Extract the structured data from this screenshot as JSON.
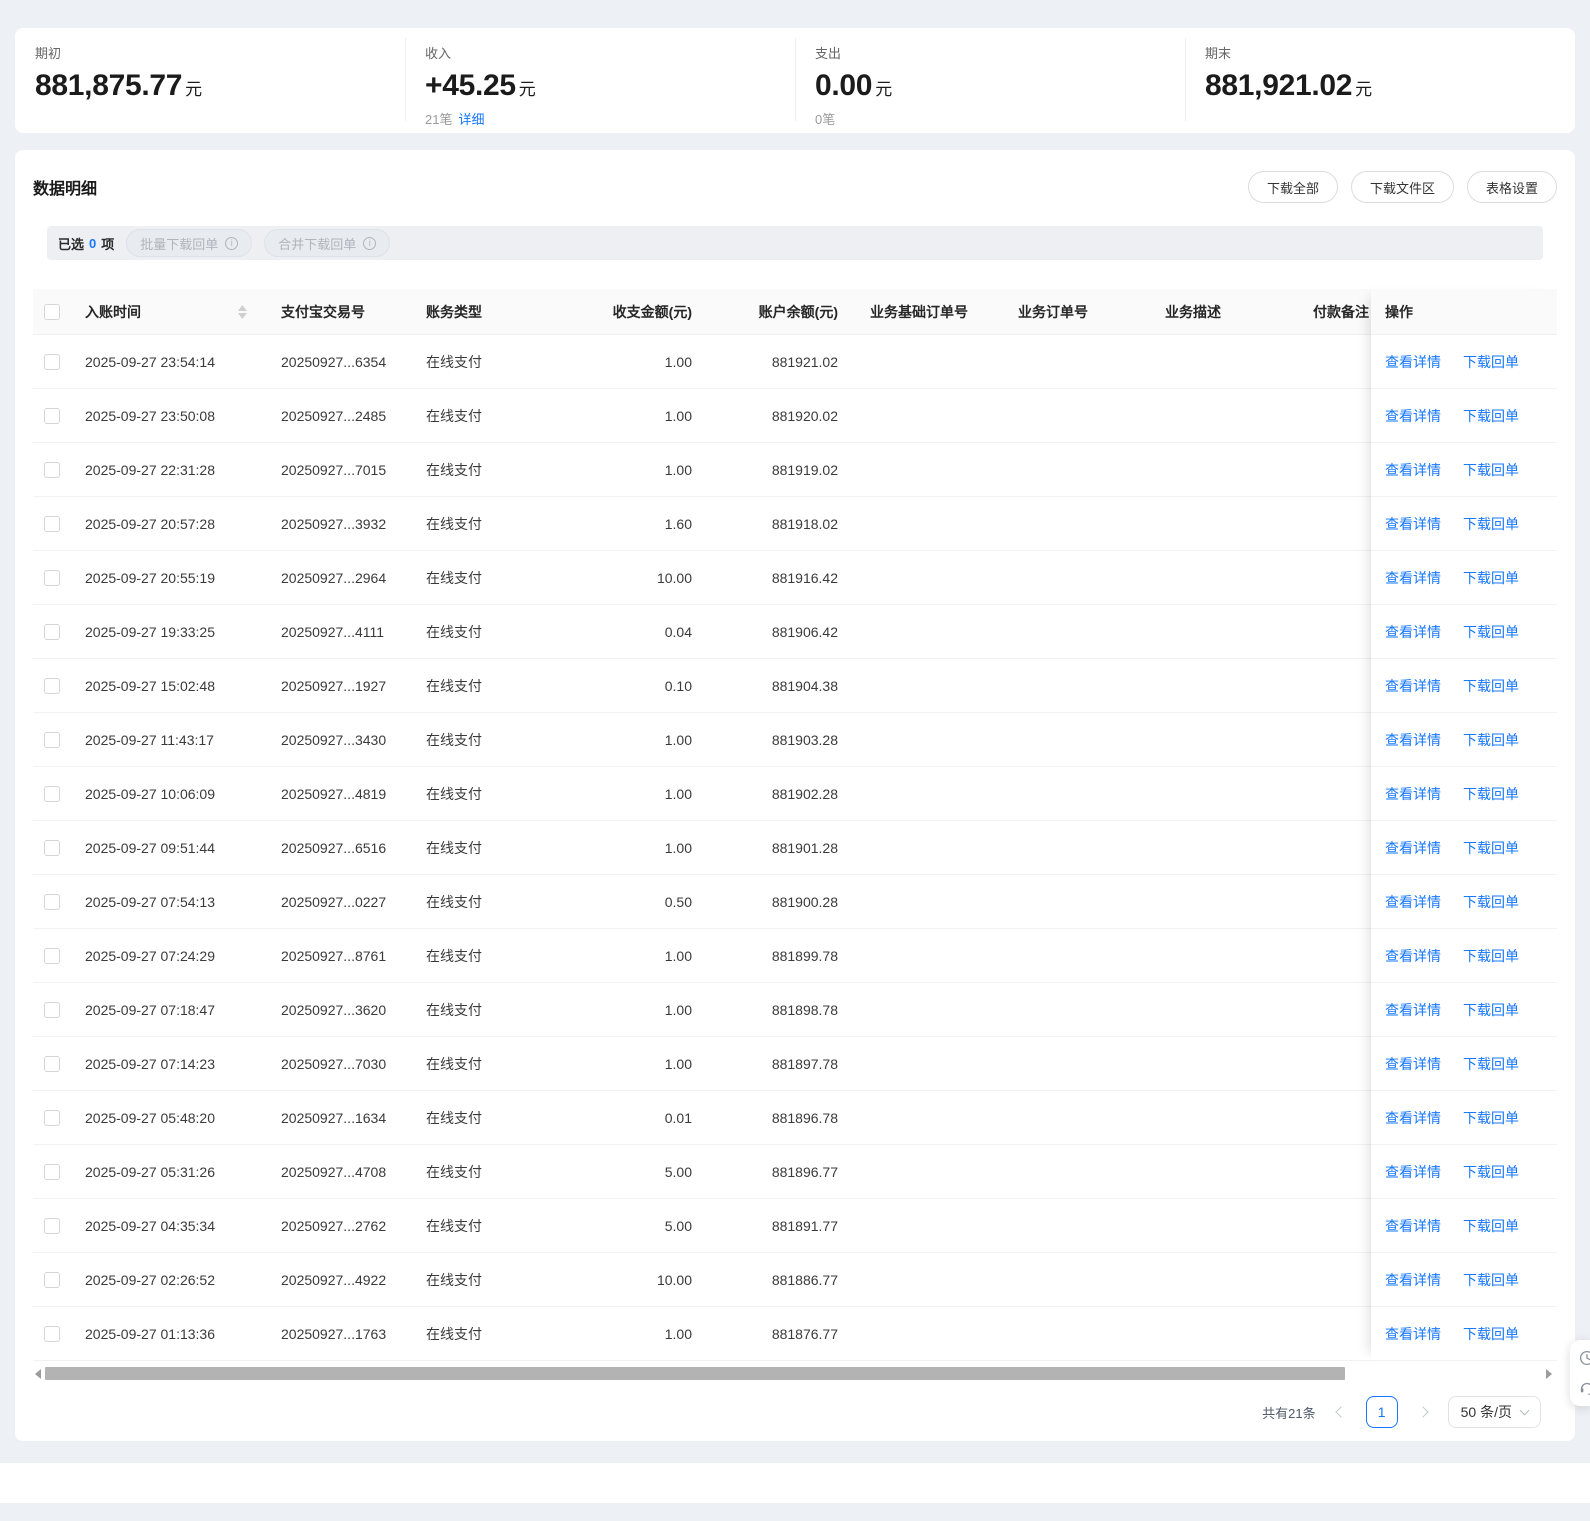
{
  "colors": {
    "accent": "#1677ff"
  },
  "summary_cards": [
    {
      "label": "期初",
      "value": "881,875.77",
      "unit": "元"
    },
    {
      "label": "收入",
      "value": "+45.25",
      "unit": "元",
      "count": "21笔",
      "link": "详细"
    },
    {
      "label": "支出",
      "value": "0.00",
      "unit": "元",
      "count": "0笔"
    },
    {
      "label": "期末",
      "value": "881,921.02",
      "unit": "元"
    }
  ],
  "panel": {
    "title": "数据明细",
    "buttons": {
      "download_all": "下载全部",
      "download_zone": "下载文件区",
      "table_settings": "表格设置"
    },
    "selection": {
      "prefix": "已选",
      "count": "0",
      "suffix": "项",
      "batch_download": "批量下载回单",
      "merge_download": "合并下载回单"
    }
  },
  "table": {
    "columns": {
      "time": "入账时间",
      "txn": "支付宝交易号",
      "type": "账务类型",
      "amount": "收支金额(元)",
      "balance": "账户余额(元)",
      "base_order": "业务基础订单号",
      "order": "业务订单号",
      "desc": "业务描述",
      "remark": "付款备注",
      "ops": "操作"
    },
    "actions": {
      "detail": "查看详情",
      "receipt": "下载回单"
    },
    "rows": [
      {
        "time": "2025-09-27 23:54:14",
        "txn": "20250927...6354",
        "type": "在线支付",
        "amount": "1.00",
        "balance": "881921.02"
      },
      {
        "time": "2025-09-27 23:50:08",
        "txn": "20250927...2485",
        "type": "在线支付",
        "amount": "1.00",
        "balance": "881920.02"
      },
      {
        "time": "2025-09-27 22:31:28",
        "txn": "20250927...7015",
        "type": "在线支付",
        "amount": "1.00",
        "balance": "881919.02"
      },
      {
        "time": "2025-09-27 20:57:28",
        "txn": "20250927...3932",
        "type": "在线支付",
        "amount": "1.60",
        "balance": "881918.02"
      },
      {
        "time": "2025-09-27 20:55:19",
        "txn": "20250927...2964",
        "type": "在线支付",
        "amount": "10.00",
        "balance": "881916.42"
      },
      {
        "time": "2025-09-27 19:33:25",
        "txn": "20250927...4111",
        "type": "在线支付",
        "amount": "0.04",
        "balance": "881906.42"
      },
      {
        "time": "2025-09-27 15:02:48",
        "txn": "20250927...1927",
        "type": "在线支付",
        "amount": "0.10",
        "balance": "881904.38"
      },
      {
        "time": "2025-09-27 11:43:17",
        "txn": "20250927...3430",
        "type": "在线支付",
        "amount": "1.00",
        "balance": "881903.28"
      },
      {
        "time": "2025-09-27 10:06:09",
        "txn": "20250927...4819",
        "type": "在线支付",
        "amount": "1.00",
        "balance": "881902.28"
      },
      {
        "time": "2025-09-27 09:51:44",
        "txn": "20250927...6516",
        "type": "在线支付",
        "amount": "1.00",
        "balance": "881901.28"
      },
      {
        "time": "2025-09-27 07:54:13",
        "txn": "20250927...0227",
        "type": "在线支付",
        "amount": "0.50",
        "balance": "881900.28"
      },
      {
        "time": "2025-09-27 07:24:29",
        "txn": "20250927...8761",
        "type": "在线支付",
        "amount": "1.00",
        "balance": "881899.78"
      },
      {
        "time": "2025-09-27 07:18:47",
        "txn": "20250927...3620",
        "type": "在线支付",
        "amount": "1.00",
        "balance": "881898.78"
      },
      {
        "time": "2025-09-27 07:14:23",
        "txn": "20250927...7030",
        "type": "在线支付",
        "amount": "1.00",
        "balance": "881897.78"
      },
      {
        "time": "2025-09-27 05:48:20",
        "txn": "20250927...1634",
        "type": "在线支付",
        "amount": "0.01",
        "balance": "881896.78"
      },
      {
        "time": "2025-09-27 05:31:26",
        "txn": "20250927...4708",
        "type": "在线支付",
        "amount": "5.00",
        "balance": "881896.77"
      },
      {
        "time": "2025-09-27 04:35:34",
        "txn": "20250927...2762",
        "type": "在线支付",
        "amount": "5.00",
        "balance": "881891.77"
      },
      {
        "time": "2025-09-27 02:26:52",
        "txn": "20250927...4922",
        "type": "在线支付",
        "amount": "10.00",
        "balance": "881886.77"
      },
      {
        "time": "2025-09-27 01:13:36",
        "txn": "20250927...1763",
        "type": "在线支付",
        "amount": "1.00",
        "balance": "881876.77"
      }
    ]
  },
  "pagination": {
    "total": "共有21条",
    "current_page": "1",
    "page_size": "50 条/页"
  }
}
